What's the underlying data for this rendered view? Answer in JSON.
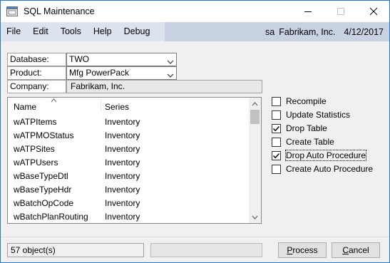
{
  "window": {
    "title": "SQL Maintenance"
  },
  "menu": {
    "items": [
      "File",
      "Edit",
      "Tools",
      "Help",
      "Debug"
    ],
    "user": "sa",
    "company": "Fabrikam, Inc.",
    "date": "4/12/2017"
  },
  "form": {
    "database_label": "Database:",
    "database_value": "TWO",
    "product_label": "Product:",
    "product_value": "Mfg PowerPack",
    "company_label": "Company:",
    "company_value": "Fabrikam, Inc."
  },
  "list": {
    "columns": [
      "Name",
      "Series"
    ],
    "rows": [
      {
        "name": "wATPItems",
        "series": "Inventory"
      },
      {
        "name": "wATPMOStatus",
        "series": "Inventory"
      },
      {
        "name": "wATPSites",
        "series": "Inventory"
      },
      {
        "name": "wATPUsers",
        "series": "Inventory"
      },
      {
        "name": "wBaseTypeDtl",
        "series": "Inventory"
      },
      {
        "name": "wBaseTypeHdr",
        "series": "Inventory"
      },
      {
        "name": "wBatchOpCode",
        "series": "Inventory"
      },
      {
        "name": "wBatchPlanRouting",
        "series": "Inventory"
      }
    ]
  },
  "options": [
    {
      "label": "Recompile",
      "checked": false
    },
    {
      "label": "Update Statistics",
      "checked": false
    },
    {
      "label": "Drop Table",
      "checked": true
    },
    {
      "label": "Create Table",
      "checked": false
    },
    {
      "label": "Drop Auto Procedure",
      "checked": true,
      "focused": true
    },
    {
      "label": "Create Auto Procedure",
      "checked": false
    }
  ],
  "status": {
    "text": "57 object(s)"
  },
  "buttons": {
    "process_accel": "P",
    "process_rest": "rocess",
    "cancel_accel": "C",
    "cancel_rest": "ancel"
  }
}
